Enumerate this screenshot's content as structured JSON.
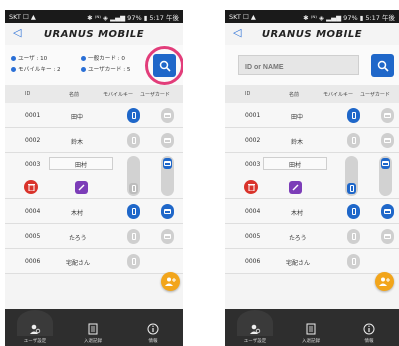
{
  "status": {
    "left": "SKT ☐ ▲",
    "right": "✱ ⁽ᴺ⁾ ◈ ▂▄▆ 97% ▮ 5:17 午後"
  },
  "app": {
    "title": "URANUS MOBILE",
    "back": "◁"
  },
  "summary": {
    "user_count": "ユーザ : 10",
    "mobile_key_count": "モバイルキー : 2",
    "general_card_count": "一般カード : 0",
    "user_card_count": "ユーザカード : 5"
  },
  "search": {
    "placeholder": "ID or NAME"
  },
  "table": {
    "headers": [
      "ID",
      "名前",
      "モバイルキー",
      "ユーザカード"
    ],
    "rows": [
      {
        "id": "0001",
        "name": "田中",
        "mobile_key": "on",
        "user_card": "off"
      },
      {
        "id": "0002",
        "name": "鈴木",
        "mobile_key": "off",
        "user_card": "off"
      },
      {
        "id": "0003",
        "name": "田村",
        "mobile_key": "off",
        "user_card": "on"
      },
      {
        "id": "0004",
        "name": "木村",
        "mobile_key": "on",
        "user_card": "on"
      },
      {
        "id": "0005",
        "name": "たろう",
        "mobile_key": "off",
        "user_card": "off"
      },
      {
        "id": "0006",
        "name": "宅配さん",
        "mobile_key": "off",
        "user_card": "off"
      }
    ]
  },
  "bottom_nav": {
    "users": "ユーザ設定",
    "log": "入退記録",
    "info": "情報"
  },
  "colors": {
    "accent": "#1f67c9",
    "delete": "#d9332b",
    "edit": "#7c3db8",
    "fab": "#f2a51b",
    "highlight": "#e23d7a"
  },
  "icons": [
    "search-icon",
    "back-icon",
    "phone-icon",
    "card-icon",
    "trash-icon",
    "edit-icon",
    "add-user-icon",
    "users-icon",
    "log-icon",
    "info-icon"
  ]
}
